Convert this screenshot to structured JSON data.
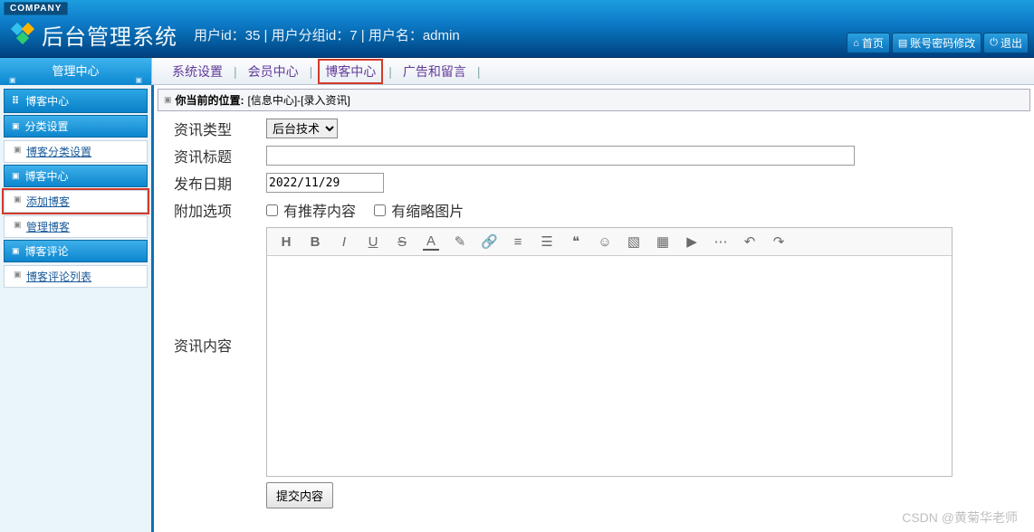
{
  "header": {
    "company_tag": "COMPANY",
    "app_title": "后台管理系统",
    "user_line": "用户id：35 | 用户分组id：7 | 用户名：admin",
    "btn_home": "首页",
    "btn_passwd": "账号密码修改",
    "btn_logout": "退出"
  },
  "subnav": {
    "mgmt_label": "管理中心",
    "links": [
      "系统设置",
      "会员中心",
      "博客中心",
      "广告和留言"
    ]
  },
  "sidebar": {
    "head": "博客中心",
    "groups": [
      {
        "title": "分类设置",
        "items": [
          "博客分类设置"
        ]
      },
      {
        "title": "博客中心",
        "items": [
          "添加博客",
          "管理博客"
        ]
      },
      {
        "title": "博客评论",
        "items": [
          "博客评论列表"
        ]
      }
    ]
  },
  "crumb": {
    "label": "你当前的位置:",
    "path": "[信息中心]-[录入资讯]"
  },
  "form": {
    "type_label": "资讯类型",
    "type_value": "后台技术",
    "title_label": "资讯标题",
    "title_value": "",
    "date_label": "发布日期",
    "date_value": "2022/11/29",
    "extra_label": "附加选项",
    "chk_rec": "有推荐内容",
    "chk_thumb": "有缩略图片",
    "content_label": "资讯内容",
    "submit": "提交内容"
  },
  "toolbar_icons": [
    "H",
    "B",
    "I",
    "U",
    "S",
    "A",
    "brush",
    "link",
    "list-ol",
    "list-ul",
    "quote",
    "smile",
    "image",
    "table",
    "video",
    "ellipsis",
    "undo",
    "redo"
  ],
  "watermark": "CSDN @黄菊华老师"
}
